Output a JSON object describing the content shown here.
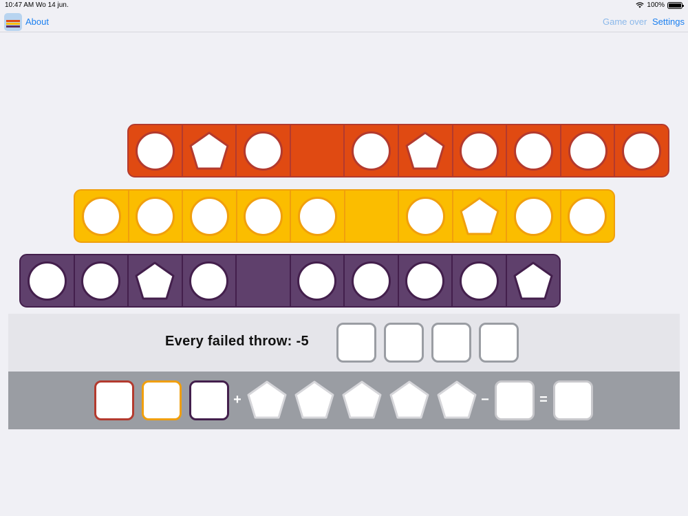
{
  "status_bar": {
    "time": "10:47 AM",
    "date": "Wo 14 jun.",
    "battery": "100%"
  },
  "nav": {
    "about": "About",
    "game_over": "Game over",
    "settings": "Settings"
  },
  "rows": [
    {
      "color": "orange",
      "cells": [
        "circle",
        "pentagon",
        "circle",
        "empty",
        "circle",
        "pentagon",
        "circle",
        "circle",
        "circle",
        "circle"
      ]
    },
    {
      "color": "yellow",
      "cells": [
        "circle",
        "circle",
        "circle",
        "circle",
        "circle",
        "empty",
        "circle",
        "pentagon",
        "circle",
        "circle"
      ]
    },
    {
      "color": "purple",
      "cells": [
        "circle",
        "circle",
        "pentagon",
        "circle",
        "empty",
        "circle",
        "circle",
        "circle",
        "circle",
        "pentagon"
      ]
    }
  ],
  "colors": {
    "orange": "#e04a12",
    "yellow": "#fbbd00",
    "purple": "#5f406c",
    "accent": "#1a7ff0"
  },
  "failed": {
    "label": "Every failed throw: -5",
    "box_count": 4
  },
  "score": {
    "plus": "+",
    "minus": "−",
    "equals": "="
  }
}
